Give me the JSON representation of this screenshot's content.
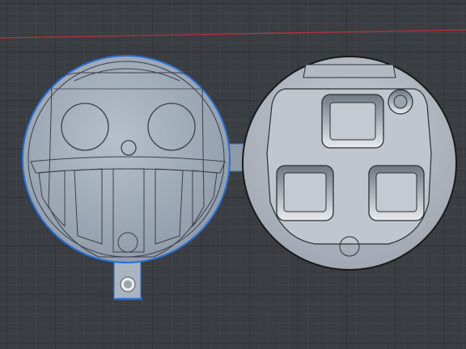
{
  "viewport": {
    "background_color": "#3a3d42",
    "grid_minor_color": "#4a4e54",
    "grid_major_color": "#2c2f33",
    "axis_color": "#c0303a"
  },
  "parts": {
    "left_part": {
      "name": "skull-face-plate",
      "selected": true,
      "fill_color": "#a9b3c0",
      "outline_color": "#2a6fd6"
    },
    "right_part": {
      "name": "button-holder-plate",
      "selected": false,
      "fill_color": "#b8bfc8",
      "outline_color": "#1a1a1a"
    }
  }
}
